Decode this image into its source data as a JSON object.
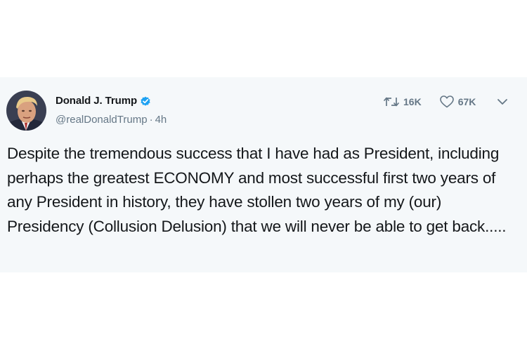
{
  "tweet": {
    "author": {
      "display_name": "Donald J. Trump",
      "handle": "@realDonaldTrump",
      "separator": "·",
      "time_ago": "4h",
      "verified": true
    },
    "stats": {
      "retweets": "16K",
      "likes": "67K"
    },
    "text": "Despite the tremendous success that I have had as President, including perhaps the greatest ECONOMY and most successful first two years of any President in history, they have stollen two years of my (our) Presidency (Collusion Delusion) that we will never be able to get back.....",
    "icons": [
      "verified-badge-icon",
      "retweet-icon",
      "heart-icon",
      "chevron-down-icon"
    ]
  },
  "colors": {
    "card_background": "#f5f8fa",
    "text_primary": "#14171a",
    "text_secondary": "#657786",
    "verified_blue": "#1da1f2"
  }
}
